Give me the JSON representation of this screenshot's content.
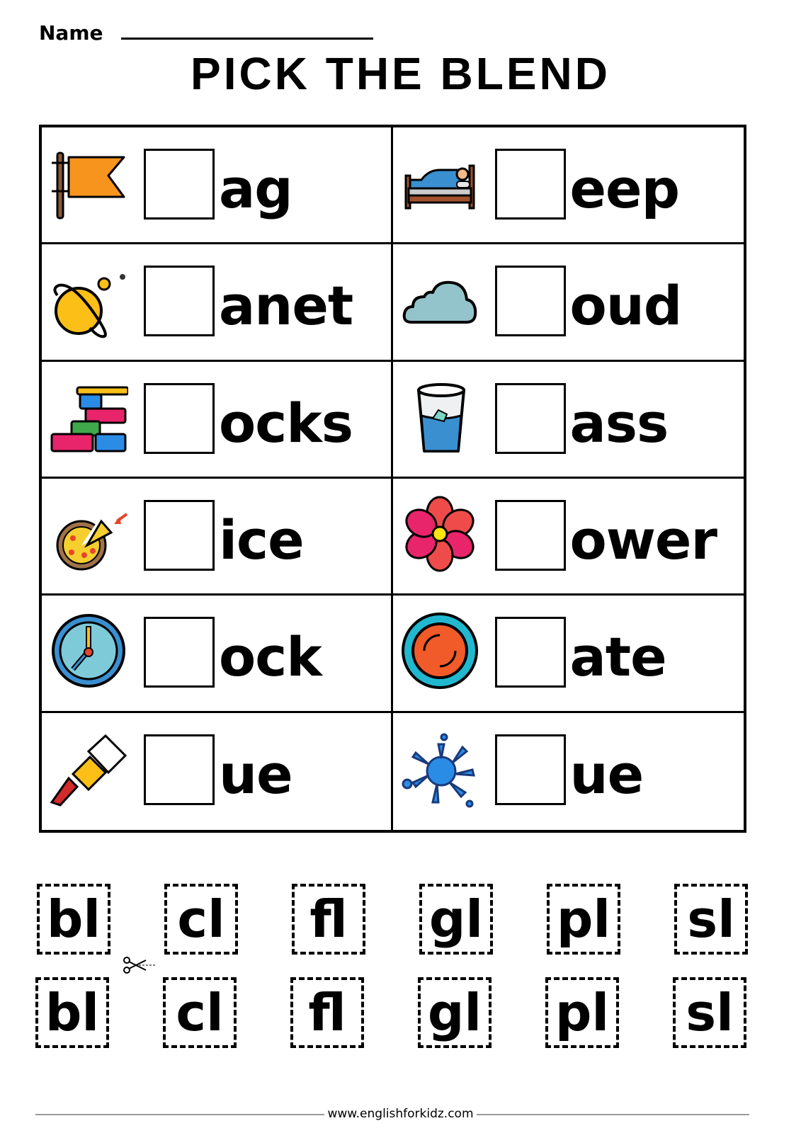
{
  "header": {
    "name_label": "Name",
    "title": "PICK THE BLEND"
  },
  "items": [
    {
      "picture": "flag",
      "ending": "ag"
    },
    {
      "picture": "sleep-bed",
      "ending": "eep"
    },
    {
      "picture": "planet",
      "ending": "anet"
    },
    {
      "picture": "cloud",
      "ending": "oud"
    },
    {
      "picture": "blocks",
      "ending": "ocks"
    },
    {
      "picture": "glass",
      "ending": "ass"
    },
    {
      "picture": "pizza-slice",
      "ending": "ice"
    },
    {
      "picture": "flower",
      "ending": "ower"
    },
    {
      "picture": "clock",
      "ending": "ock"
    },
    {
      "picture": "plate",
      "ending": "ate"
    },
    {
      "picture": "glue",
      "ending": "ue"
    },
    {
      "picture": "blue-splash",
      "ending": "ue"
    }
  ],
  "cutout_tiles": {
    "row1": [
      "bl",
      "cl",
      "fl",
      "gl",
      "pl",
      "sl"
    ],
    "row2": [
      "bl",
      "cl",
      "fl",
      "gl",
      "pl",
      "sl"
    ]
  },
  "footer": {
    "website": "www.englishforkidz.com"
  }
}
